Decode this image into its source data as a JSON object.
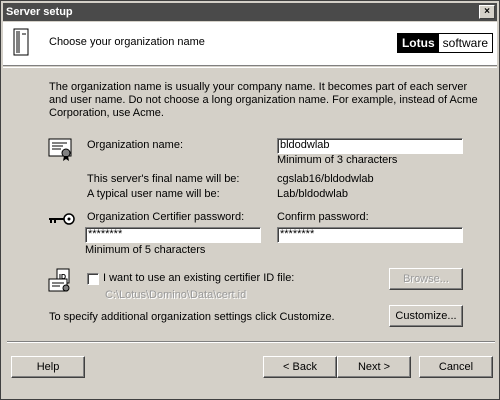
{
  "window": {
    "title": "Server setup",
    "close": "×"
  },
  "header": {
    "title": "Choose your organization name",
    "logo_a": "Lotus",
    "logo_b": "software"
  },
  "description": "The organization name is usually your company name. It becomes part of each server and user name. Do not choose a long organization name. For example, instead of Acme Corporation, use Acme.",
  "org": {
    "label": "Organization name:",
    "value": "bldodwlab",
    "hint": "Minimum of 3 characters"
  },
  "server_name": {
    "label": "This server's final name will be:",
    "value": "cgslab16/bldodwlab"
  },
  "user_name": {
    "label": "A typical user name will be:",
    "value": "Lab/bldodwlab"
  },
  "certifier": {
    "label": "Organization Certifier password:",
    "value": "********",
    "hint": "Minimum of 5 characters"
  },
  "confirm": {
    "label": "Confirm password:",
    "value": "********"
  },
  "existing_id": {
    "label": "I want to use an existing certifier ID file:",
    "path": "C:\\Lotus\\Domino\\Data\\cert.id",
    "browse": "Browse..."
  },
  "customize": {
    "text": "To specify additional organization settings click Customize.",
    "button": "Customize..."
  },
  "footer": {
    "help": "Help",
    "back": "< Back",
    "next": "Next >",
    "cancel": "Cancel"
  }
}
